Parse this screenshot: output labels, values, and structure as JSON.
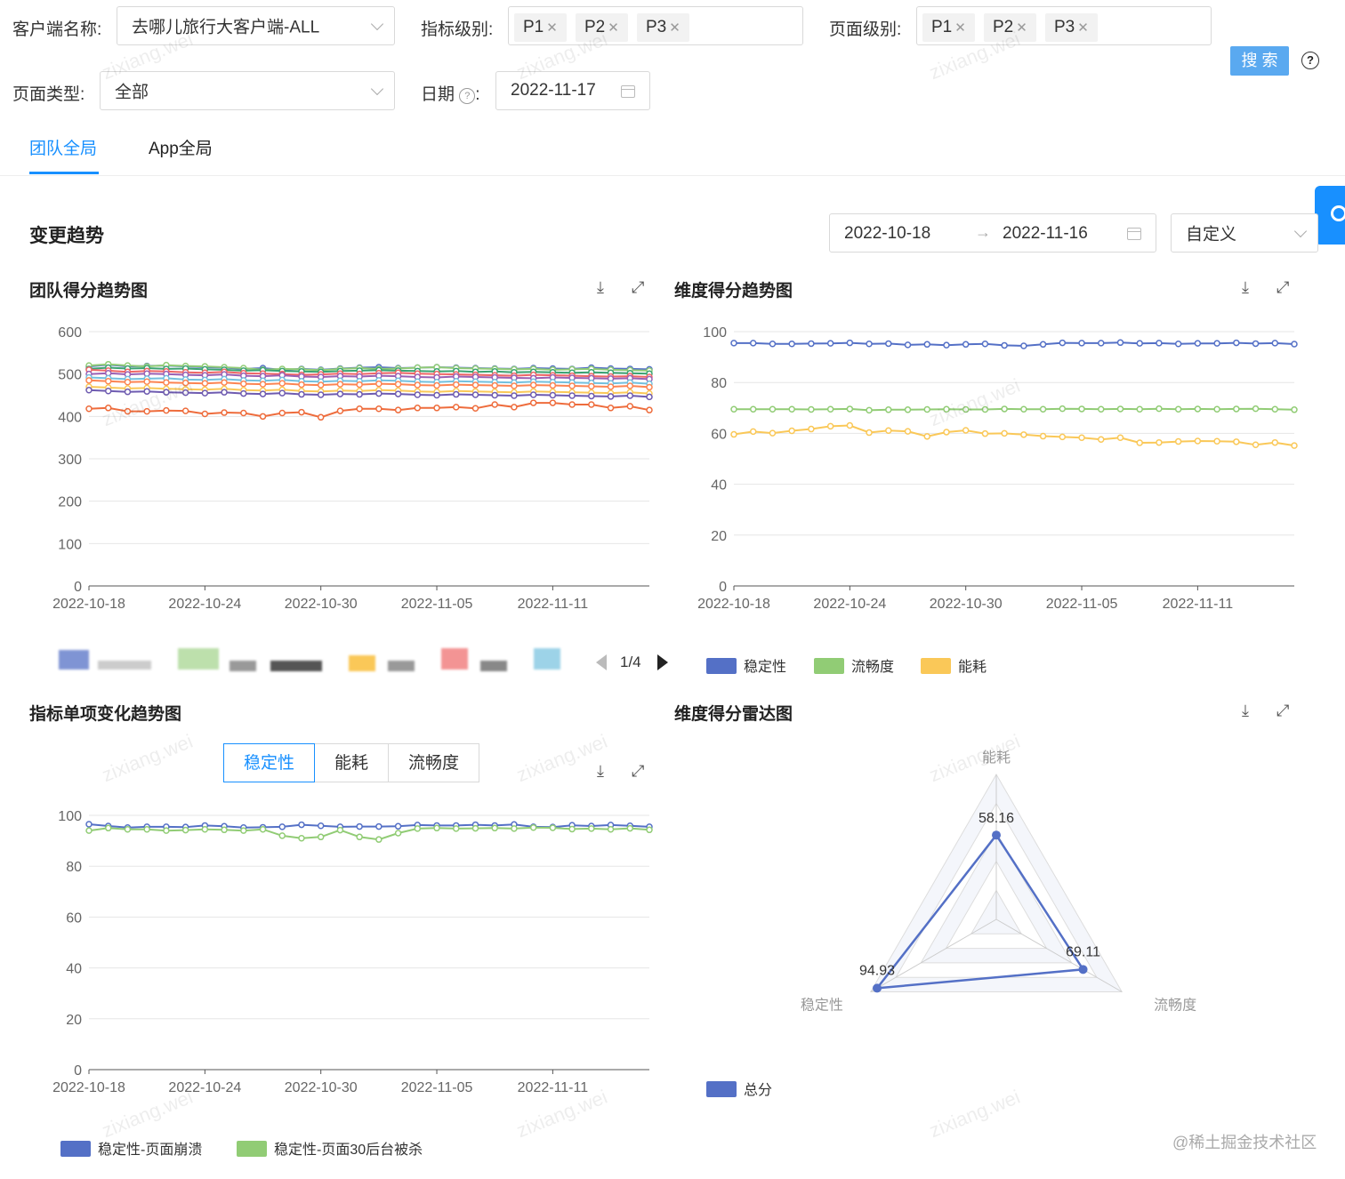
{
  "filters": {
    "client_label": "客户端名称:",
    "client_value": "去哪儿旅行大客户端-ALL",
    "metric_level_label": "指标级别:",
    "metric_levels": [
      "P1",
      "P2",
      "P3"
    ],
    "page_level_label": "页面级别:",
    "page_levels": [
      "P1",
      "P2",
      "P3"
    ],
    "search_label": "搜 索",
    "page_type_label": "页面类型:",
    "page_type_value": "全部",
    "date_label": "日期",
    "date_value": "2022-11-17"
  },
  "tabs": [
    "团队全局",
    "App全局"
  ],
  "section": {
    "title": "变更趋势",
    "range_start": "2022-10-18",
    "range_end": "2022-11-16",
    "range_mode": "自定义"
  },
  "pagination": "1/4",
  "dimension_toggle": [
    "稳定性",
    "能耗",
    "流畅度"
  ],
  "colors": {
    "accent": "#1890ff",
    "blue": "#5470c6",
    "green": "#91cc75",
    "yellow": "#fac858",
    "orange": "#ee6c3c"
  },
  "watermark": "zixiang.wei",
  "footer_credit": "@稀土掘金技术社区",
  "chart_data": [
    {
      "id": "team",
      "type": "line",
      "title": "团队得分趋势图",
      "x": [
        "2022-10-18",
        "2022-10-19",
        "2022-10-20",
        "2022-10-21",
        "2022-10-22",
        "2022-10-23",
        "2022-10-24",
        "2022-10-25",
        "2022-10-26",
        "2022-10-27",
        "2022-10-28",
        "2022-10-29",
        "2022-10-30",
        "2022-10-31",
        "2022-11-01",
        "2022-11-02",
        "2022-11-03",
        "2022-11-04",
        "2022-11-05",
        "2022-11-06",
        "2022-11-07",
        "2022-11-08",
        "2022-11-09",
        "2022-11-10",
        "2022-11-11",
        "2022-11-12",
        "2022-11-13",
        "2022-11-14",
        "2022-11-15",
        "2022-11-16"
      ],
      "xticks": [
        "2022-10-18",
        "2022-10-24",
        "2022-10-30",
        "2022-11-05",
        "2022-11-11"
      ],
      "ylim": [
        0,
        600
      ],
      "yticks": [
        0,
        100,
        200,
        300,
        400,
        500,
        600
      ],
      "grid": true,
      "series": [
        {
          "color": "#5470c6",
          "values": [
            518,
            522,
            518,
            519,
            520,
            518,
            516,
            515,
            512,
            514,
            510,
            512,
            510,
            513,
            515,
            516,
            514,
            515,
            516,
            515,
            514,
            513,
            512,
            514,
            513,
            512,
            515,
            513,
            512,
            511
          ]
        },
        {
          "color": "#91cc75",
          "values": [
            520,
            523,
            520,
            518,
            521,
            519,
            518,
            516,
            514,
            510,
            512,
            511,
            509,
            512,
            514,
            512,
            513,
            515,
            516,
            514,
            513,
            512,
            511,
            512,
            510,
            511,
            512,
            510,
            509,
            508
          ]
        },
        {
          "color": "#3ba272",
          "values": [
            512,
            515,
            513,
            514,
            512,
            513,
            511,
            510,
            508,
            509,
            507,
            506,
            505,
            507,
            508,
            509,
            508,
            507,
            506,
            507,
            505,
            506,
            504,
            505,
            504,
            503,
            504,
            503,
            502,
            501
          ]
        },
        {
          "color": "#ee6666",
          "values": [
            510,
            508,
            505,
            507,
            506,
            504,
            503,
            505,
            502,
            501,
            500,
            498,
            499,
            501,
            500,
            502,
            503,
            501,
            500,
            499,
            498,
            497,
            496,
            498,
            497,
            496,
            495,
            494,
            495,
            493
          ]
        },
        {
          "color": "#9a60b4",
          "values": [
            500,
            502,
            499,
            501,
            500,
            498,
            497,
            499,
            496,
            495,
            497,
            494,
            493,
            495,
            494,
            496,
            495,
            493,
            492,
            494,
            493,
            492,
            491,
            490,
            492,
            491,
            490,
            489,
            490,
            488
          ]
        },
        {
          "color": "#73c0de",
          "values": [
            492,
            490,
            488,
            489,
            490,
            487,
            486,
            488,
            485,
            484,
            486,
            483,
            482,
            484,
            483,
            485,
            484,
            482,
            481,
            483,
            482,
            481,
            480,
            482,
            481,
            480,
            479,
            478,
            480,
            477
          ]
        },
        {
          "color": "#fc8452",
          "values": [
            485,
            483,
            481,
            482,
            480,
            479,
            478,
            480,
            477,
            476,
            478,
            475,
            474,
            476,
            475,
            477,
            476,
            474,
            473,
            475,
            474,
            473,
            472,
            474,
            473,
            472,
            471,
            470,
            472,
            469
          ]
        },
        {
          "color": "#fac858",
          "values": [
            470,
            468,
            466,
            467,
            465,
            464,
            463,
            465,
            462,
            461,
            463,
            460,
            459,
            461,
            460,
            462,
            461,
            459,
            458,
            460,
            459,
            458,
            457,
            459,
            458,
            457,
            456,
            455,
            457,
            454
          ]
        },
        {
          "color": "#6e5bb0",
          "values": [
            462,
            460,
            458,
            459,
            457,
            456,
            455,
            457,
            454,
            453,
            455,
            452,
            451,
            453,
            452,
            454,
            453,
            451,
            450,
            452,
            451,
            450,
            449,
            451,
            450,
            449,
            448,
            447,
            449,
            446
          ]
        },
        {
          "color": "#ee6c3c",
          "values": [
            418,
            420,
            412,
            412,
            414,
            413,
            406,
            409,
            408,
            400,
            408,
            410,
            398,
            413,
            418,
            418,
            415,
            420,
            420,
            422,
            419,
            428,
            422,
            432,
            432,
            428,
            428,
            420,
            424,
            415
          ]
        }
      ]
    },
    {
      "id": "dim",
      "type": "line",
      "title": "维度得分趋势图",
      "x": [
        "2022-10-18",
        "2022-10-19",
        "2022-10-20",
        "2022-10-21",
        "2022-10-22",
        "2022-10-23",
        "2022-10-24",
        "2022-10-25",
        "2022-10-26",
        "2022-10-27",
        "2022-10-28",
        "2022-10-29",
        "2022-10-30",
        "2022-10-31",
        "2022-11-01",
        "2022-11-02",
        "2022-11-03",
        "2022-11-04",
        "2022-11-05",
        "2022-11-06",
        "2022-11-07",
        "2022-11-08",
        "2022-11-09",
        "2022-11-10",
        "2022-11-11",
        "2022-11-12",
        "2022-11-13",
        "2022-11-14",
        "2022-11-15",
        "2022-11-16"
      ],
      "xticks": [
        "2022-10-18",
        "2022-10-24",
        "2022-10-30",
        "2022-11-05",
        "2022-11-11"
      ],
      "ylim": [
        0,
        100
      ],
      "yticks": [
        0,
        20,
        40,
        60,
        80,
        100
      ],
      "grid": true,
      "legend": "bottom",
      "series": [
        {
          "name": "稳定性",
          "color": "#5470c6",
          "values": [
            95.5,
            95.5,
            95.2,
            95.2,
            95.3,
            95.4,
            95.6,
            95.2,
            95.3,
            94.8,
            95.0,
            94.7,
            95.0,
            95.2,
            94.6,
            94.4,
            95.0,
            95.6,
            95.5,
            95.5,
            95.7,
            95.4,
            95.5,
            95.2,
            95.4,
            95.4,
            95.6,
            95.3,
            95.5,
            95.1
          ]
        },
        {
          "name": "流畅度",
          "color": "#91cc75",
          "values": [
            69.5,
            69.5,
            69.5,
            69.5,
            69.4,
            69.5,
            69.6,
            69.1,
            69.3,
            69.3,
            69.4,
            69.5,
            69.4,
            69.4,
            69.6,
            69.5,
            69.5,
            69.7,
            69.6,
            69.5,
            69.6,
            69.5,
            69.7,
            69.5,
            69.6,
            69.5,
            69.6,
            69.7,
            69.5,
            69.3
          ]
        },
        {
          "name": "能耗",
          "color": "#fac858",
          "values": [
            59.6,
            60.7,
            60.1,
            61.0,
            61.7,
            62.8,
            63.1,
            60.3,
            61.1,
            60.8,
            58.8,
            60.5,
            61.2,
            59.9,
            60.0,
            59.5,
            58.9,
            58.6,
            58.3,
            57.6,
            58.3,
            56.3,
            56.4,
            56.8,
            57.0,
            56.9,
            56.7,
            55.5,
            56.4,
            55.2
          ]
        }
      ]
    },
    {
      "id": "metric",
      "type": "line",
      "title": "指标单项变化趋势图",
      "x": [
        "2022-10-18",
        "2022-10-19",
        "2022-10-20",
        "2022-10-21",
        "2022-10-22",
        "2022-10-23",
        "2022-10-24",
        "2022-10-25",
        "2022-10-26",
        "2022-10-27",
        "2022-10-28",
        "2022-10-29",
        "2022-10-30",
        "2022-10-31",
        "2022-11-01",
        "2022-11-02",
        "2022-11-03",
        "2022-11-04",
        "2022-11-05",
        "2022-11-06",
        "2022-11-07",
        "2022-11-08",
        "2022-11-09",
        "2022-11-10",
        "2022-11-11",
        "2022-11-12",
        "2022-11-13",
        "2022-11-14",
        "2022-11-15",
        "2022-11-16"
      ],
      "xticks": [
        "2022-10-18",
        "2022-10-24",
        "2022-10-30",
        "2022-11-05",
        "2022-11-11"
      ],
      "ylim": [
        0,
        100
      ],
      "yticks": [
        0,
        20,
        40,
        60,
        80,
        100
      ],
      "grid": true,
      "legend": "bottom",
      "series": [
        {
          "name": "稳定性-页面崩溃",
          "color": "#5470c6",
          "values": [
            96.5,
            95.8,
            95.2,
            95.5,
            95.5,
            95.4,
            96.0,
            95.7,
            95.2,
            95.3,
            95.5,
            96.3,
            95.9,
            95.5,
            95.6,
            95.6,
            95.7,
            96.2,
            96.0,
            96.0,
            96.3,
            96.0,
            96.4,
            95.5,
            95.4,
            96.1,
            95.8,
            96.2,
            95.9,
            95.5
          ]
        },
        {
          "name": "稳定性-页面30后台被杀",
          "color": "#91cc75",
          "values": [
            94.0,
            95.0,
            94.5,
            94.5,
            94.0,
            94.2,
            94.5,
            94.3,
            94.0,
            94.5,
            92.0,
            91.0,
            91.5,
            94.2,
            91.5,
            90.5,
            93.0,
            94.8,
            95.0,
            94.8,
            94.9,
            95.0,
            94.8,
            95.2,
            95.1,
            94.6,
            94.8,
            94.5,
            94.9,
            94.3
          ]
        }
      ]
    },
    {
      "id": "radar",
      "type": "radar",
      "title": "维度得分雷达图",
      "indicators": [
        "能耗",
        "流畅度",
        "稳定性"
      ],
      "max": 100,
      "legend": "bottom",
      "series": [
        {
          "name": "总分",
          "color": "#5470c6",
          "values": [
            58.16,
            69.11,
            94.93
          ]
        }
      ]
    }
  ]
}
